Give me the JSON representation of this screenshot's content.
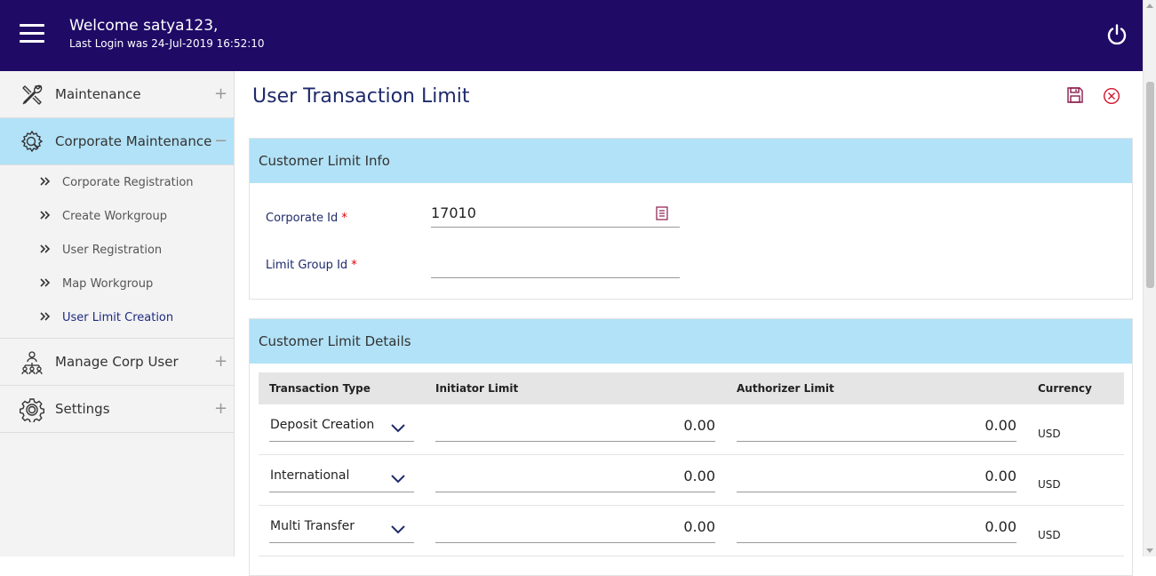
{
  "header": {
    "welcome": "Welcome satya123,",
    "last_login": "Last Login was 24-Jul-2019 16:52:10",
    "icons": {
      "menu": "hamburger-icon",
      "logout": "power-icon"
    }
  },
  "sidebar": {
    "items": [
      {
        "label": "Maintenance",
        "icon": "tools-icon",
        "toggle": "+"
      },
      {
        "label": "Corporate Maintenance",
        "icon": "gear-search-icon",
        "toggle": "−"
      },
      {
        "label": "Manage Corp User",
        "icon": "org-chart-icon",
        "toggle": "+"
      },
      {
        "label": "Settings",
        "icon": "gear-icon",
        "toggle": "+"
      }
    ],
    "sub_items": [
      {
        "label": "Corporate Registration"
      },
      {
        "label": "Create Workgroup"
      },
      {
        "label": "User Registration"
      },
      {
        "label": "Map Workgroup"
      },
      {
        "label": "User Limit Creation"
      }
    ]
  },
  "main": {
    "title": "User Transaction Limit",
    "info_panel": {
      "heading": "Customer Limit Info",
      "corporate_id_label": "Corporate Id",
      "corporate_id_value": "17010",
      "limit_group_label": "Limit Group Id",
      "limit_group_value": "",
      "required_mark": "*"
    },
    "details_panel": {
      "heading": "Customer Limit Details",
      "columns": [
        "Transaction Type",
        "Initiator Limit",
        "Authorizer Limit",
        "Currency"
      ],
      "rows": [
        {
          "type": "Deposit Creation",
          "initiator": "0.00",
          "authorizer": "0.00",
          "currency": "USD"
        },
        {
          "type": "International",
          "initiator": "0.00",
          "authorizer": "0.00",
          "currency": "USD"
        },
        {
          "type": "Multi Transfer",
          "initiator": "0.00",
          "authorizer": "0.00",
          "currency": "USD"
        }
      ]
    }
  },
  "colors": {
    "header_bg": "#1f0a66",
    "panel_head_bg": "#b2e2f7",
    "title": "#1f2a6b",
    "required": "#dd0000",
    "close_icon": "#d0142c",
    "save_icon": "#8b1a4a"
  }
}
